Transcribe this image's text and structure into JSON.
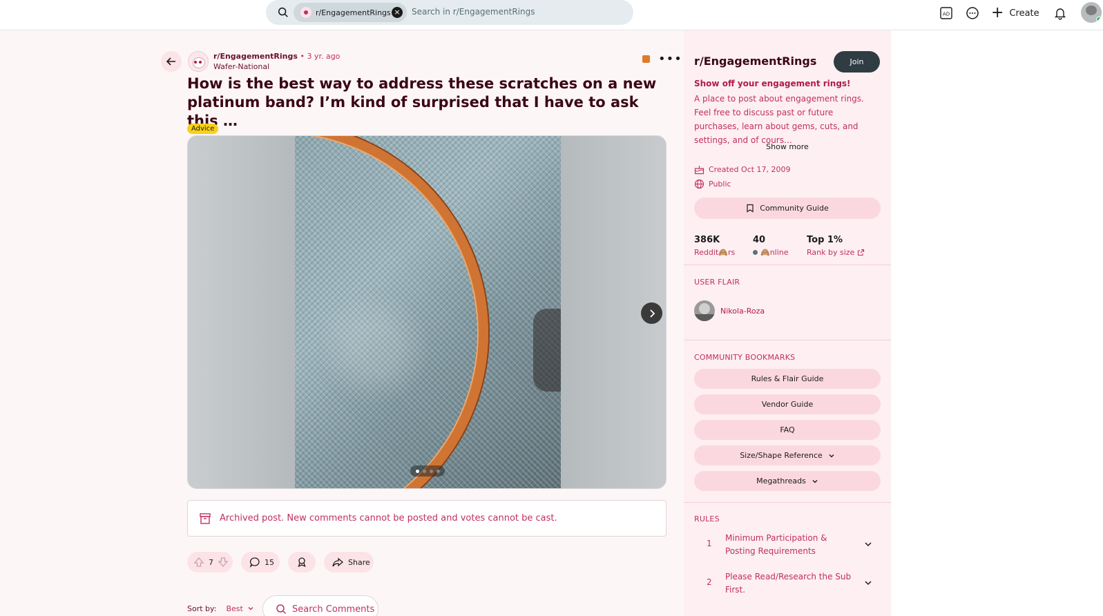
{
  "search": {
    "chip_label": "r/EngagementRings",
    "placeholder": "Search in r/EngagementRings"
  },
  "header": {
    "create_label": "Create"
  },
  "post": {
    "subreddit": "r/EngagementRings",
    "separator": "•",
    "time": "3 yr. ago",
    "author": "Wafer-National",
    "title": "How is the best way to address these scratches on a new platinum band? I’m kind of surprised that I have to ask this …",
    "flair": "Advice",
    "carousel": {
      "total": 4,
      "current": 1
    },
    "archived_notice": "Archived post. New comments cannot be posted and votes cannot be cast.",
    "votes": "7",
    "comments": "15",
    "share_label": "Share",
    "sort_label": "Sort by:",
    "sort_value": "Best",
    "search_comments_label": "Search Comments"
  },
  "sidebar": {
    "title": "r/EngagementRings",
    "join_label": "Join",
    "headline": "Show off your engagement rings!",
    "description": "A place to post about engagement rings. Feel free to discuss past or future purchases, learn about gems, cuts, and settings, and of cours…",
    "show_more": "Show more",
    "created": "Created Oct 17, 2009",
    "visibility": "Public",
    "guide_label": "Community Guide",
    "stats": [
      {
        "value": "386K",
        "label": "Reddit🙈rs"
      },
      {
        "value": "40",
        "label": "🙈nline"
      },
      {
        "value": "Top 1%",
        "label": "Rank by size"
      }
    ],
    "user_flair_heading": "USER FLAIR",
    "user_flair_name": "Nikola-Roza",
    "bookmarks_heading": "COMMUNITY BOOKMARKS",
    "bookmarks": [
      {
        "label": "Rules & Flair Guide",
        "dropdown": false
      },
      {
        "label": "Vendor Guide",
        "dropdown": false
      },
      {
        "label": "FAQ",
        "dropdown": false
      },
      {
        "label": "Size/Shape Reference",
        "dropdown": true
      },
      {
        "label": "Megathreads",
        "dropdown": true
      }
    ],
    "rules_heading": "RULES",
    "rules": [
      {
        "number": "1",
        "text": "Minimum Participation & Posting Requirements"
      },
      {
        "number": "2",
        "text": "Please Read/Research the Sub First."
      }
    ]
  },
  "colors": {
    "accent": "#c0305d",
    "dark_accent": "#6b0f2b",
    "sidebar_bg": "#fdeff2",
    "pill_bg": "#fbe3e8",
    "flair_bg": "#f7d118"
  }
}
